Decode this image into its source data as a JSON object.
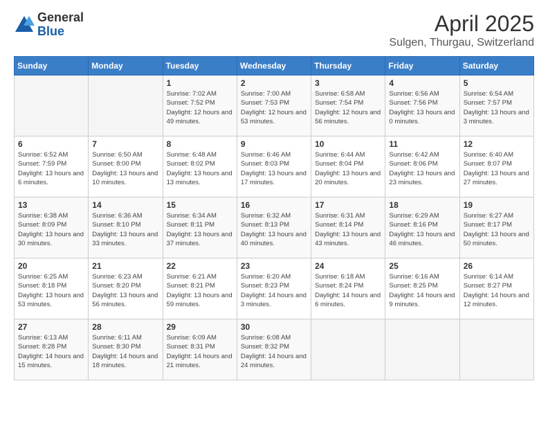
{
  "header": {
    "logo_general": "General",
    "logo_blue": "Blue",
    "title": "April 2025",
    "location": "Sulgen, Thurgau, Switzerland"
  },
  "days_of_week": [
    "Sunday",
    "Monday",
    "Tuesday",
    "Wednesday",
    "Thursday",
    "Friday",
    "Saturday"
  ],
  "weeks": [
    [
      {
        "day": "",
        "content": ""
      },
      {
        "day": "",
        "content": ""
      },
      {
        "day": "1",
        "content": "Sunrise: 7:02 AM\nSunset: 7:52 PM\nDaylight: 12 hours\nand 49 minutes."
      },
      {
        "day": "2",
        "content": "Sunrise: 7:00 AM\nSunset: 7:53 PM\nDaylight: 12 hours\nand 53 minutes."
      },
      {
        "day": "3",
        "content": "Sunrise: 6:58 AM\nSunset: 7:54 PM\nDaylight: 12 hours\nand 56 minutes."
      },
      {
        "day": "4",
        "content": "Sunrise: 6:56 AM\nSunset: 7:56 PM\nDaylight: 13 hours\nand 0 minutes."
      },
      {
        "day": "5",
        "content": "Sunrise: 6:54 AM\nSunset: 7:57 PM\nDaylight: 13 hours\nand 3 minutes."
      }
    ],
    [
      {
        "day": "6",
        "content": "Sunrise: 6:52 AM\nSunset: 7:59 PM\nDaylight: 13 hours\nand 6 minutes."
      },
      {
        "day": "7",
        "content": "Sunrise: 6:50 AM\nSunset: 8:00 PM\nDaylight: 13 hours\nand 10 minutes."
      },
      {
        "day": "8",
        "content": "Sunrise: 6:48 AM\nSunset: 8:02 PM\nDaylight: 13 hours\nand 13 minutes."
      },
      {
        "day": "9",
        "content": "Sunrise: 6:46 AM\nSunset: 8:03 PM\nDaylight: 13 hours\nand 17 minutes."
      },
      {
        "day": "10",
        "content": "Sunrise: 6:44 AM\nSunset: 8:04 PM\nDaylight: 13 hours\nand 20 minutes."
      },
      {
        "day": "11",
        "content": "Sunrise: 6:42 AM\nSunset: 8:06 PM\nDaylight: 13 hours\nand 23 minutes."
      },
      {
        "day": "12",
        "content": "Sunrise: 6:40 AM\nSunset: 8:07 PM\nDaylight: 13 hours\nand 27 minutes."
      }
    ],
    [
      {
        "day": "13",
        "content": "Sunrise: 6:38 AM\nSunset: 8:09 PM\nDaylight: 13 hours\nand 30 minutes."
      },
      {
        "day": "14",
        "content": "Sunrise: 6:36 AM\nSunset: 8:10 PM\nDaylight: 13 hours\nand 33 minutes."
      },
      {
        "day": "15",
        "content": "Sunrise: 6:34 AM\nSunset: 8:11 PM\nDaylight: 13 hours\nand 37 minutes."
      },
      {
        "day": "16",
        "content": "Sunrise: 6:32 AM\nSunset: 8:13 PM\nDaylight: 13 hours\nand 40 minutes."
      },
      {
        "day": "17",
        "content": "Sunrise: 6:31 AM\nSunset: 8:14 PM\nDaylight: 13 hours\nand 43 minutes."
      },
      {
        "day": "18",
        "content": "Sunrise: 6:29 AM\nSunset: 8:16 PM\nDaylight: 13 hours\nand 46 minutes."
      },
      {
        "day": "19",
        "content": "Sunrise: 6:27 AM\nSunset: 8:17 PM\nDaylight: 13 hours\nand 50 minutes."
      }
    ],
    [
      {
        "day": "20",
        "content": "Sunrise: 6:25 AM\nSunset: 8:18 PM\nDaylight: 13 hours\nand 53 minutes."
      },
      {
        "day": "21",
        "content": "Sunrise: 6:23 AM\nSunset: 8:20 PM\nDaylight: 13 hours\nand 56 minutes."
      },
      {
        "day": "22",
        "content": "Sunrise: 6:21 AM\nSunset: 8:21 PM\nDaylight: 13 hours\nand 59 minutes."
      },
      {
        "day": "23",
        "content": "Sunrise: 6:20 AM\nSunset: 8:23 PM\nDaylight: 14 hours\nand 3 minutes."
      },
      {
        "day": "24",
        "content": "Sunrise: 6:18 AM\nSunset: 8:24 PM\nDaylight: 14 hours\nand 6 minutes."
      },
      {
        "day": "25",
        "content": "Sunrise: 6:16 AM\nSunset: 8:25 PM\nDaylight: 14 hours\nand 9 minutes."
      },
      {
        "day": "26",
        "content": "Sunrise: 6:14 AM\nSunset: 8:27 PM\nDaylight: 14 hours\nand 12 minutes."
      }
    ],
    [
      {
        "day": "27",
        "content": "Sunrise: 6:13 AM\nSunset: 8:28 PM\nDaylight: 14 hours\nand 15 minutes."
      },
      {
        "day": "28",
        "content": "Sunrise: 6:11 AM\nSunset: 8:30 PM\nDaylight: 14 hours\nand 18 minutes."
      },
      {
        "day": "29",
        "content": "Sunrise: 6:09 AM\nSunset: 8:31 PM\nDaylight: 14 hours\nand 21 minutes."
      },
      {
        "day": "30",
        "content": "Sunrise: 6:08 AM\nSunset: 8:32 PM\nDaylight: 14 hours\nand 24 minutes."
      },
      {
        "day": "",
        "content": ""
      },
      {
        "day": "",
        "content": ""
      },
      {
        "day": "",
        "content": ""
      }
    ]
  ]
}
